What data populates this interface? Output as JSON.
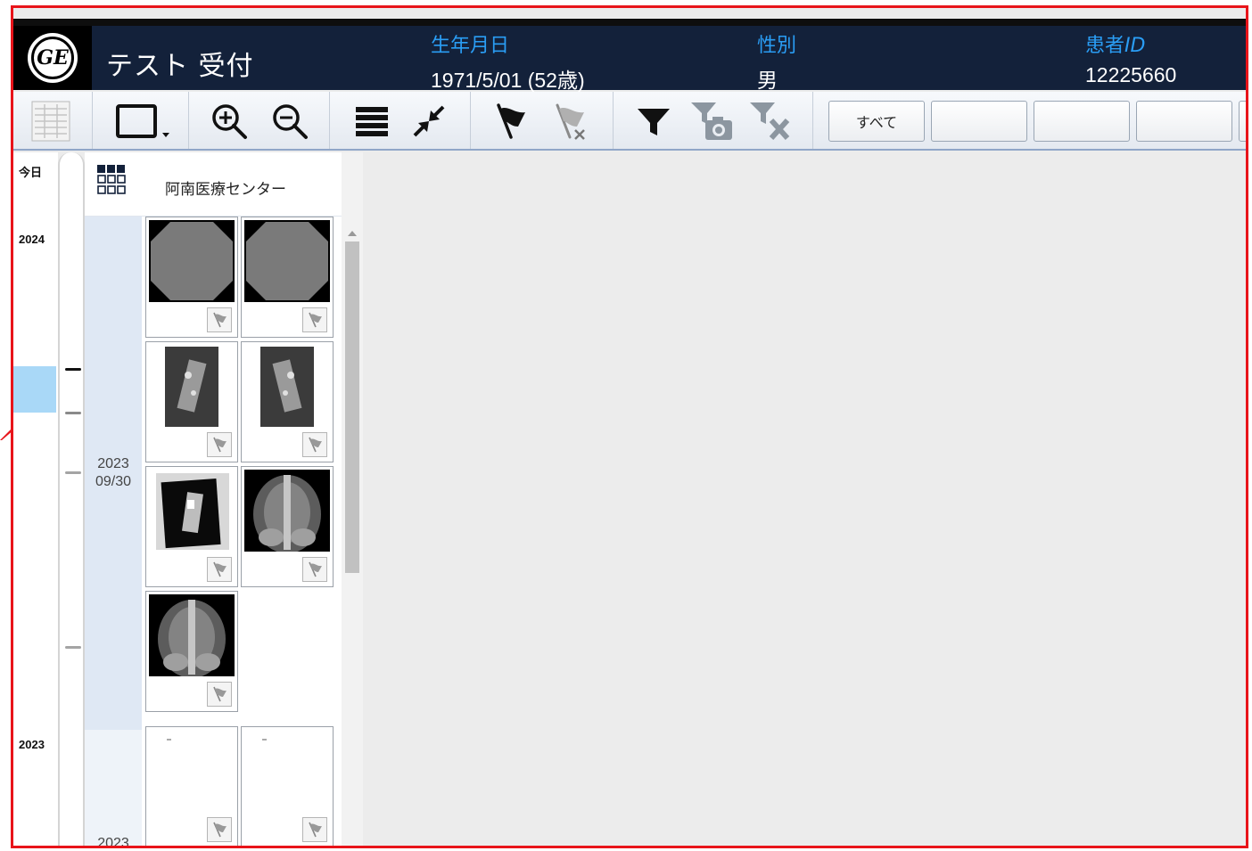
{
  "header": {
    "logo": "GE",
    "title": "テスト 受付",
    "dob_label": "生年月日",
    "dob_value": "1971/5/01 (52歳)",
    "sex_label": "性別",
    "sex_value": "男",
    "patient_id_label_prefix": "患者",
    "patient_id_label_suffix": "ID",
    "patient_id_value": "12225660"
  },
  "toolbar": {
    "icons": [
      "worklist-icon",
      "layout-icon",
      "zoom-in-icon",
      "zoom-out-icon",
      "list-icon",
      "collapse-icon",
      "flag-icon",
      "unflag-icon",
      "filter-icon",
      "filter-camera-icon",
      "clear-filter-icon"
    ],
    "filter_buttons": [
      "すべて",
      "",
      "",
      ""
    ]
  },
  "timeline": {
    "today_label": "今日",
    "year_top": "2024",
    "year_bottom": "2023"
  },
  "study": {
    "organization": "阿南医療センター",
    "date_1_year": "2023",
    "date_1_md": "09/30",
    "date_2_year": "2023"
  },
  "colors": {
    "header_bg": "#13213a",
    "label_blue": "#2a9df4",
    "frame_red": "#e8141a",
    "timeline_highlight": "#a9d8f7"
  }
}
